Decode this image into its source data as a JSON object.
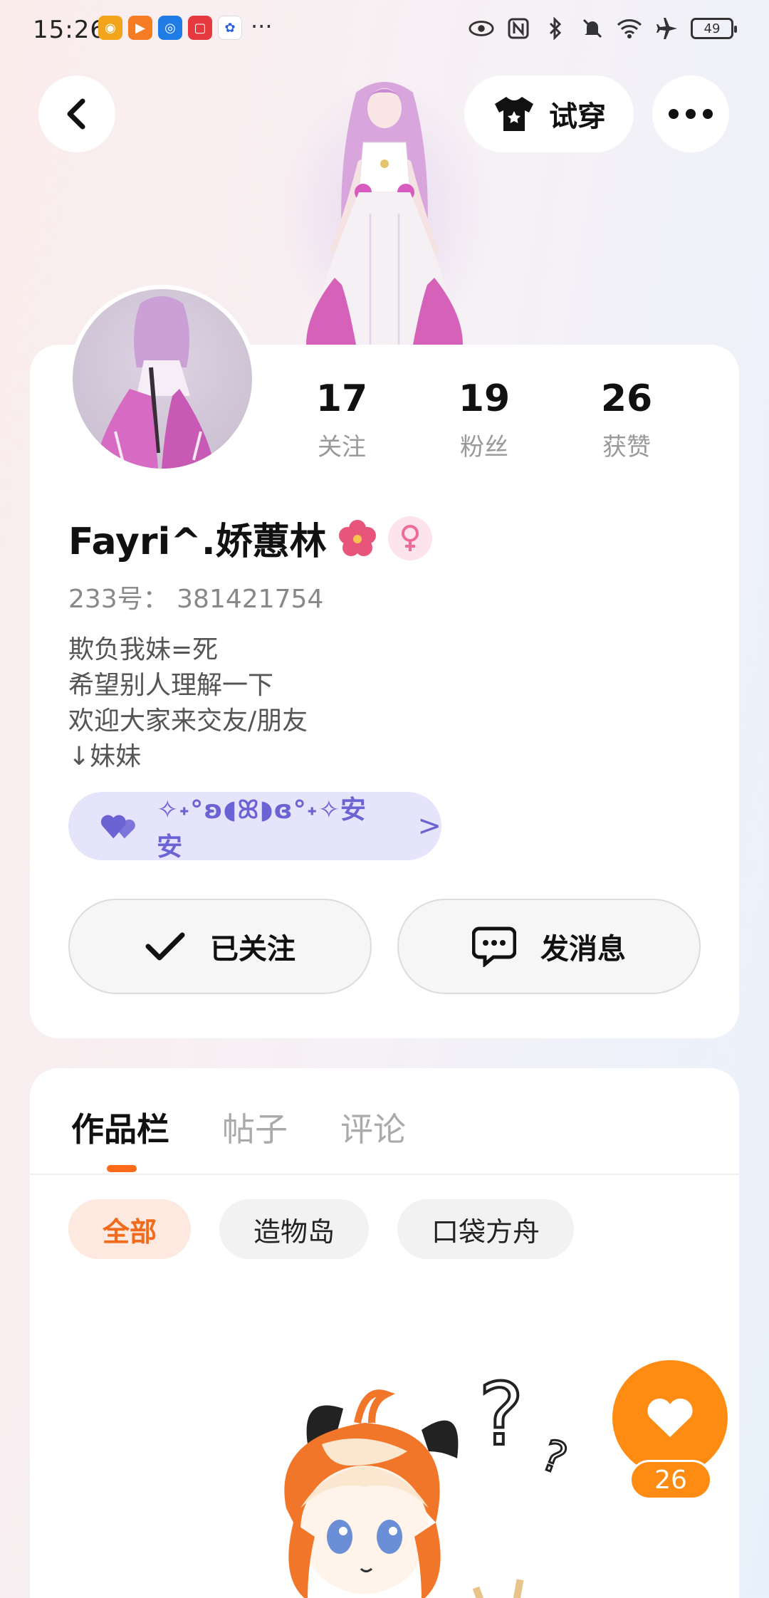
{
  "status_bar": {
    "time": "15:26",
    "more": "···",
    "battery": "49",
    "app_icons": [
      "weibo-icon",
      "video-icon",
      "bulb-icon",
      "note-icon",
      "baidu-icon"
    ],
    "system_icons": [
      "eye-icon",
      "nfc-icon",
      "bluetooth-icon",
      "mute-icon",
      "wifi-icon",
      "airplane-icon"
    ]
  },
  "header": {
    "tryon_label": "试穿"
  },
  "profile": {
    "stats": [
      {
        "value": "17",
        "label": "关注"
      },
      {
        "value": "19",
        "label": "粉丝"
      },
      {
        "value": "26",
        "label": "获赞"
      }
    ],
    "username": "Fayri^.娇蕙林",
    "uid": "233号： 381421754",
    "bio": [
      "欺负我妹=死",
      "希望别人理解一下",
      "欢迎大家来交友/朋友",
      "↓妹妹"
    ],
    "guild": {
      "text": "✧˖°ʚ◖ꕤ◗ɞ°˖✧安安",
      "chevron": ">"
    },
    "follow_label": "已关注",
    "message_label": "发消息"
  },
  "works": {
    "tabs": [
      "作品栏",
      "帖子",
      "评论"
    ],
    "active_tab": 0,
    "chips": [
      "全部",
      "造物岛",
      "口袋方舟"
    ],
    "active_chip": 0
  },
  "like": {
    "count": "26"
  },
  "colors": {
    "accent_orange": "#ff8c12",
    "guild_purple": "#6b63d4",
    "guild_bg": "#e5e4fa",
    "tab_indicator": "#ff6a1a"
  }
}
